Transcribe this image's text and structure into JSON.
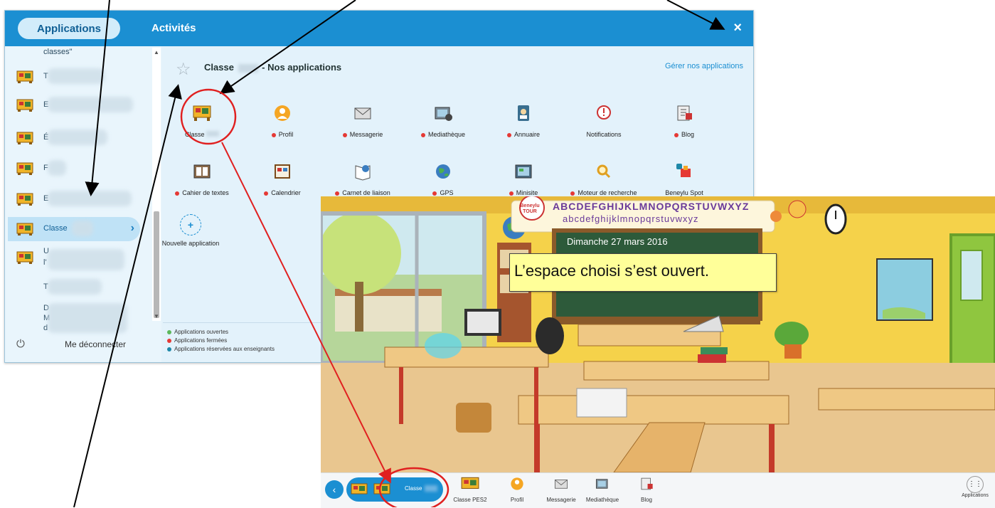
{
  "header": {
    "tab_applications": "Applications",
    "tab_activities": "Activités",
    "close_icon": "×"
  },
  "sidebar": {
    "partial_top": "classes\"",
    "items": [
      {
        "label": "T",
        "icon": "class-board-icon"
      },
      {
        "label": "E",
        "icon": "class-board-icon"
      },
      {
        "label": "É",
        "icon": "class-board-icon"
      },
      {
        "label": "F",
        "icon": "class-board-icon"
      },
      {
        "label": "E",
        "icon": "class-board-icon"
      },
      {
        "label": "Classe",
        "icon": "class-board-icon",
        "active": true
      },
      {
        "label": "U",
        "sub": "l'",
        "icon": "class-board-icon"
      },
      {
        "label": "T",
        "icon": ""
      },
      {
        "label": "D",
        "sub": "M",
        "sub2": "d",
        "icon": ""
      }
    ],
    "logout": "Me déconnecter"
  },
  "content": {
    "title": "Classe",
    "title_suffix": "- Nos applications",
    "manage_link": "Gérer nos applications",
    "apps_row1": [
      {
        "label": "Classe",
        "dot": ""
      },
      {
        "label": "Profil",
        "dot": "red"
      },
      {
        "label": "Messagerie",
        "dot": "red"
      },
      {
        "label": "Mediathèque",
        "dot": "red"
      },
      {
        "label": "Annuaire",
        "dot": "red"
      },
      {
        "label": "Notifications",
        "dot": ""
      },
      {
        "label": "Blog",
        "dot": "red"
      }
    ],
    "apps_row2": [
      {
        "label": "Cahier de textes",
        "dot": "red"
      },
      {
        "label": "Calendrier",
        "dot": "red"
      },
      {
        "label": "Carnet de liaison",
        "dot": "red"
      },
      {
        "label": "GPS",
        "dot": "red"
      },
      {
        "label": "Minisite",
        "dot": "red"
      },
      {
        "label": "Moteur de recherche",
        "dot": "red"
      },
      {
        "label": "Beneylu Spot",
        "dot": ""
      }
    ],
    "new_app": "Nouvelle application",
    "new_app_icon": "+",
    "legend": [
      {
        "label": "Applications ouvertes",
        "color": "#5cb85c"
      },
      {
        "label": "Applications fermées",
        "color": "#e53935"
      },
      {
        "label": "Applications réservées aux enseignants",
        "color": "#1e88a8"
      }
    ]
  },
  "classroom": {
    "logo_top": "Beneylu",
    "logo_bottom": "TOUR",
    "alphabet_upper": "ABCDEFGHIJKLMNOPQRSTUVWXYZ",
    "alphabet_lower": "abcdefghijklmnopqrstuvwxyz",
    "board_date": "Dimanche 27 mars 2016",
    "callout": "L’espace choisi s’est ouvert."
  },
  "dock": {
    "back_icon": "‹",
    "selected_label": "Classe",
    "items": [
      "Classe PES2",
      "Profil",
      "Messagerie",
      "Mediathèque",
      "Blog"
    ],
    "applications": "Applications"
  },
  "colors": {
    "brand_blue": "#1b8fd2",
    "panel_bg": "#e3f2fb",
    "annotation_red": "#e02020",
    "callout_yellow": "#ffff99"
  }
}
